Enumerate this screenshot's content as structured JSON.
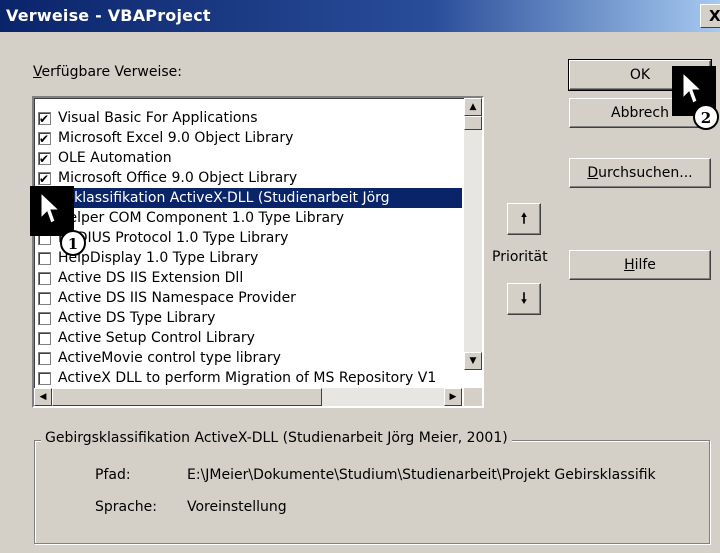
{
  "window": {
    "title": "Verweise - VBAProject",
    "close": "X"
  },
  "available_label": {
    "prefix": "",
    "accel": "V",
    "rest": "erfügbare Verweise:"
  },
  "references": [
    {
      "label": "Visual Basic For Applications",
      "checked": true,
      "selected": false
    },
    {
      "label": "Microsoft Excel 9.0 Object Library",
      "checked": true,
      "selected": false
    },
    {
      "label": "OLE Automation",
      "checked": true,
      "selected": false
    },
    {
      "label": "Microsoft Office 9.0 Object Library",
      "checked": true,
      "selected": false
    },
    {
      "label": "gsklassifikation ActiveX-DLL (Studienarbeit Jörg",
      "checked": true,
      "selected": true
    },
    {
      "label": "Helper COM Component 1.0 Type Library",
      "checked": false,
      "selected": false
    },
    {
      "label": "RADIUS Protocol 1.0 Type Library",
      "checked": false,
      "selected": false
    },
    {
      "label": "HelpDisplay 1.0 Type Library",
      "checked": false,
      "selected": false
    },
    {
      "label": "Active DS IIS Extension Dll",
      "checked": false,
      "selected": false
    },
    {
      "label": "Active DS IIS Namespace Provider",
      "checked": false,
      "selected": false
    },
    {
      "label": "Active DS Type Library",
      "checked": false,
      "selected": false
    },
    {
      "label": "Active Setup Control Library",
      "checked": false,
      "selected": false
    },
    {
      "label": "ActiveMovie control type library",
      "checked": false,
      "selected": false
    },
    {
      "label": "ActiveX DLL to perform Migration of MS Repository V1",
      "checked": false,
      "selected": false
    }
  ],
  "buttons": {
    "ok": "OK",
    "cancel": "Abbrech",
    "browse": {
      "accel": "D",
      "rest": "urchsuchen..."
    },
    "help": {
      "accel": "H",
      "rest": "ilfe"
    }
  },
  "priority_label": "Priorität",
  "details": {
    "title": "Gebirgsklassifikation ActiveX-DLL (Studienarbeit Jörg Meier, 2001)",
    "path_label": "Pfad:",
    "path_value": "E:\\JMeier\\Dokumente\\Studium\\Studienarbeit\\Projekt Gebirsklassifik",
    "language_label": "Sprache:",
    "language_value": "Voreinstellung"
  },
  "callouts": {
    "one": "1",
    "two": "2"
  },
  "icons": [
    "close-icon",
    "arrow-up-icon",
    "arrow-down-icon",
    "mouse-cursor-icon",
    "checkbox-icon"
  ]
}
